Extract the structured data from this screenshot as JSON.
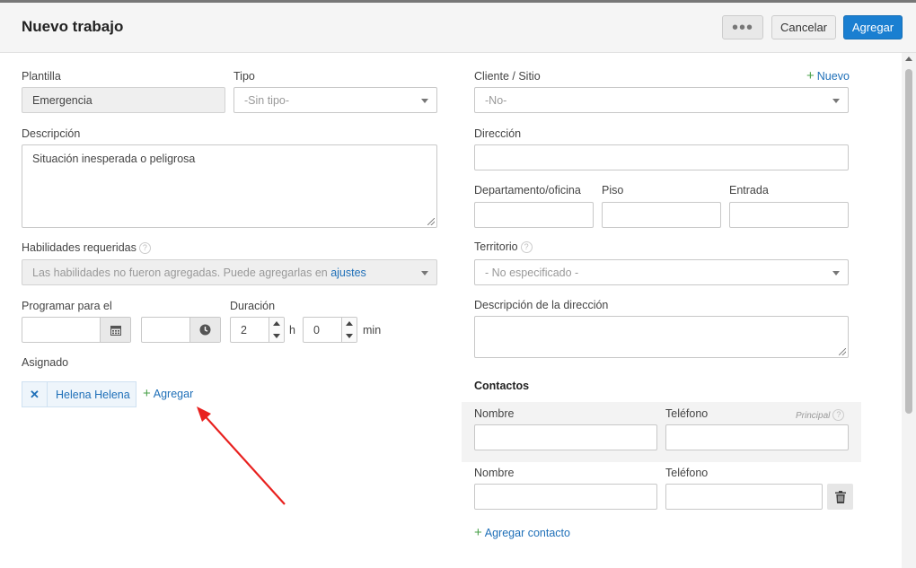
{
  "header": {
    "title": "Nuevo trabajo",
    "more_label": "•••",
    "cancel_label": "Cancelar",
    "add_label": "Agregar"
  },
  "left": {
    "plantilla": {
      "label": "Plantilla",
      "value": "Emergencia"
    },
    "tipo": {
      "label": "Tipo",
      "value": "-Sin tipo-"
    },
    "descripcion": {
      "label": "Descripción",
      "value": "Situación inesperada o peligrosa"
    },
    "habilidades": {
      "label": "Habilidades requeridas",
      "placeholder": "Las habilidades no fueron agregadas. Puede agregarlas en ",
      "link": "ajustes"
    },
    "programar": {
      "label": "Programar para el",
      "date_value": "",
      "time_value": ""
    },
    "duracion": {
      "label": "Duración",
      "hours": "2",
      "hours_unit": "h",
      "minutes": "0",
      "minutes_unit": "min"
    },
    "asignado": {
      "label": "Asignado",
      "assignee": "Helena Helena",
      "remove_label": "✕",
      "add_label": "Agregar"
    }
  },
  "right": {
    "cliente": {
      "label": "Cliente / Sitio",
      "new_label": "Nuevo",
      "value": "-No-"
    },
    "direccion": {
      "label": "Dirección",
      "value": ""
    },
    "departamento": {
      "label": "Departamento/oficina",
      "value": ""
    },
    "piso": {
      "label": "Piso",
      "value": ""
    },
    "entrada": {
      "label": "Entrada",
      "value": ""
    },
    "territorio": {
      "label": "Territorio",
      "value": "- No especificado -"
    },
    "desc_direccion": {
      "label": "Descripción de la dirección",
      "value": ""
    },
    "contactos": {
      "title": "Contactos",
      "principal_label": "Principal",
      "rows": [
        {
          "name_label": "Nombre",
          "phone_label": "Teléfono",
          "name_value": "",
          "phone_value": ""
        },
        {
          "name_label": "Nombre",
          "phone_label": "Teléfono",
          "name_value": "",
          "phone_value": ""
        }
      ],
      "add_label": "Agregar contacto"
    }
  },
  "icons": {
    "help": "question-circle-icon",
    "calendar": "calendar-icon",
    "clock": "clock-icon",
    "trash": "trash-icon",
    "plus": "plus-icon"
  },
  "colors": {
    "primary": "#1a7fd1",
    "link": "#1e6fb8",
    "plus": "#4aa14a",
    "arrow": "#e8211f"
  }
}
